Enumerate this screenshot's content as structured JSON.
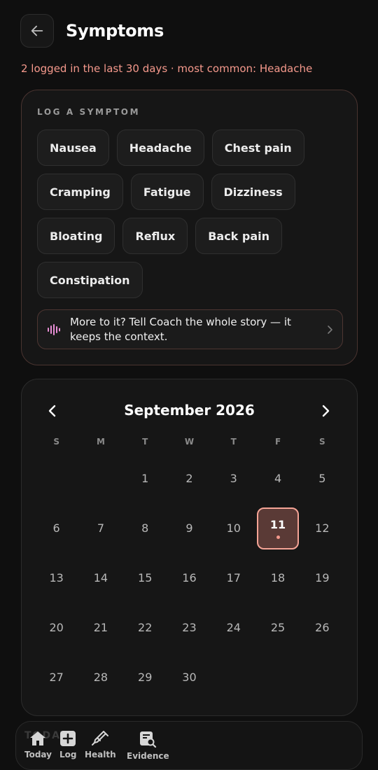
{
  "header": {
    "title": "Symptoms",
    "back_icon": "arrow-left-icon"
  },
  "summary": "2 logged in the last 30 days · most common: Headache",
  "log": {
    "label": "LOG A SYMPTOM",
    "chips": [
      "Nausea",
      "Headache",
      "Chest pain",
      "Cramping",
      "Fatigue",
      "Dizziness",
      "Bloating",
      "Reflux",
      "Back pain",
      "Constipation"
    ],
    "coach_text": "More to it? Tell Coach the whole story — it keeps the context.",
    "coach_icon": "sparkle-waveform-icon"
  },
  "calendar": {
    "title": "September 2026",
    "weekdays": [
      "S",
      "M",
      "T",
      "W",
      "T",
      "F",
      "S"
    ],
    "weeks": [
      [
        "",
        "",
        "1",
        "2",
        "3",
        "4",
        "5"
      ],
      [
        "6",
        "7",
        "8",
        "9",
        "10",
        "11",
        "12"
      ],
      [
        "13",
        "14",
        "15",
        "16",
        "17",
        "18",
        "19"
      ],
      [
        "20",
        "21",
        "22",
        "23",
        "24",
        "25",
        "26"
      ],
      [
        "27",
        "28",
        "29",
        "30",
        "",
        "",
        ""
      ]
    ],
    "selected_day": "11"
  },
  "bottom_nav": {
    "ghost_label": "TODAY",
    "items": [
      {
        "label": "Today",
        "icon": "home-icon"
      },
      {
        "label": "Log",
        "icon": "plus-square-icon"
      },
      {
        "label": "Health",
        "icon": "syringe-icon"
      },
      {
        "label": "Evidence",
        "icon": "document-search-icon"
      }
    ]
  },
  "colors": {
    "accent": "#f5998c",
    "background": "#0f0f0f",
    "card": "#161616"
  }
}
